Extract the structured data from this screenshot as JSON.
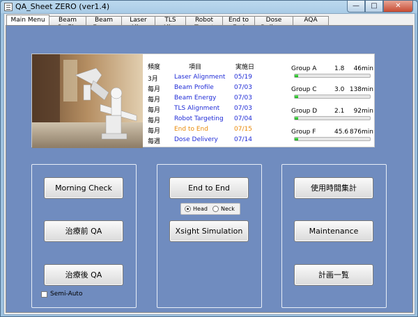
{
  "window": {
    "title": "QA_Sheet ZERO (ver1.4)"
  },
  "tabs": [
    {
      "label": "Main Menu",
      "active": true
    },
    {
      "label": "Beam Profile"
    },
    {
      "label": "Beam Energy"
    },
    {
      "label": "Laser Align"
    },
    {
      "label": "TLS Align"
    },
    {
      "label": "Robot Target"
    },
    {
      "label": "End to End"
    },
    {
      "label": "Dose Delivery"
    },
    {
      "label": "AQA"
    }
  ],
  "schedule": {
    "headers": {
      "freq": "頻度",
      "item": "項目",
      "date": "実施日"
    },
    "rows": [
      {
        "freq": "3月",
        "item": "Laser Alignment",
        "date": "05/19",
        "color": "blue"
      },
      {
        "freq": "毎月",
        "item": "Beam Profile",
        "date": "07/03",
        "color": "blue"
      },
      {
        "freq": "毎月",
        "item": "Beam Energy",
        "date": "07/03",
        "color": "blue"
      },
      {
        "freq": "毎月",
        "item": "TLS Alignment",
        "date": "07/03",
        "color": "blue"
      },
      {
        "freq": "毎月",
        "item": "Robot Targeting",
        "date": "07/04",
        "color": "blue"
      },
      {
        "freq": "毎月",
        "item": "End to End",
        "date": "07/15",
        "color": "orange"
      },
      {
        "freq": "毎週",
        "item": "Dose Delivery",
        "date": "07/14",
        "color": "blue"
      }
    ]
  },
  "groups": [
    {
      "name": "Group A",
      "value": "1.8",
      "minutes": "46min",
      "fill": 0.05
    },
    {
      "name": "Group C",
      "value": "3.0",
      "minutes": "138min",
      "fill": 0.05
    },
    {
      "name": "Group D",
      "value": "2.1",
      "minutes": "92min",
      "fill": 0.05
    },
    {
      "name": "Group F",
      "value": "45.6",
      "minutes": "876min",
      "fill": 0.05
    }
  ],
  "left_panel": {
    "morning_check": "Morning Check",
    "pre_qa": "治療前  QA",
    "post_qa": "治療後  QA",
    "semi_auto": "Semi-Auto"
  },
  "middle_panel": {
    "end_to_end": "End to End",
    "head": "Head",
    "neck": "Neck",
    "selected": "Head",
    "xsight": "Xsight Simulation"
  },
  "right_panel": {
    "usage_time": "使用時間集計",
    "maintenance": "Maintenance",
    "plan_list": "計画一覧"
  },
  "colors": {
    "blue": "#1f2bd6",
    "orange": "#e98a08",
    "panel": "#708cbf"
  }
}
